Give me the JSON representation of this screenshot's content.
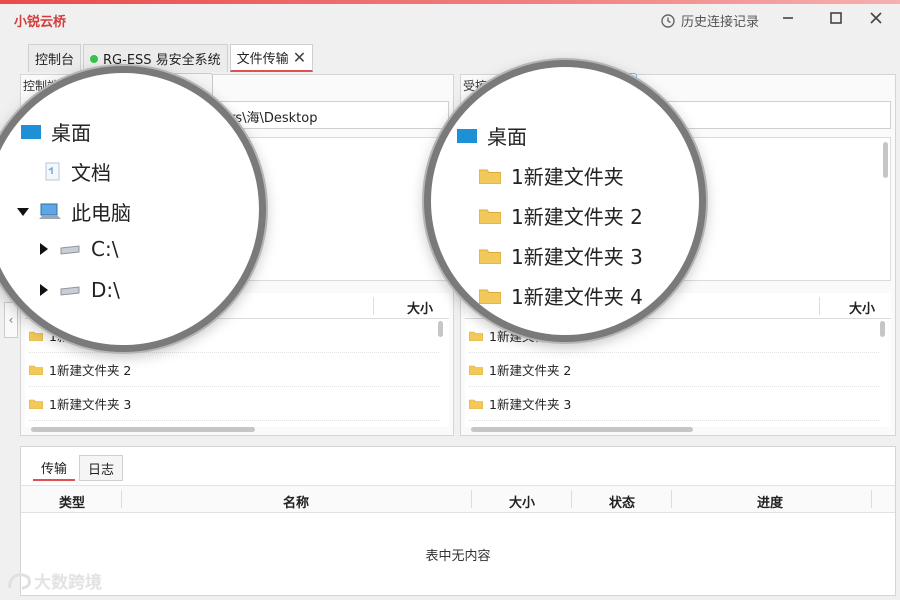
{
  "app": {
    "title": "小锐云桥",
    "history_label": "历史连接记录"
  },
  "tabs": [
    {
      "label": "控制台"
    },
    {
      "label": "RG-ESS 易安全系统",
      "status_color": "#37c24b"
    },
    {
      "label": "文件传输",
      "close": "✕"
    }
  ],
  "left_panel": {
    "header": "控制端",
    "path": "C:\\Users\\海\\Desktop",
    "path_visible": "ers\\海\\Desktop",
    "column_size": "大小",
    "files": [
      "1新建",
      "1新建文件夹 2",
      "1新建文件夹 3"
    ],
    "zoom_tree": [
      {
        "label": "桌面",
        "icon": "desktop-icon"
      },
      {
        "label": "文档",
        "icon": "document-icon"
      },
      {
        "label": "此电脑",
        "icon": "computer-icon",
        "expanded": true
      },
      {
        "label": "C:\\",
        "icon": "drive-icon"
      },
      {
        "label": "D:\\",
        "icon": "drive-icon"
      }
    ]
  },
  "right_panel": {
    "header": "受控端",
    "column_size": "大小",
    "files": [
      "1新建文件夹",
      "1新建文件夹 2",
      "1新建文件夹 3"
    ],
    "zoom_tree": [
      {
        "label": "桌面",
        "icon": "desktop-icon"
      },
      {
        "label": "1新建文件夹",
        "icon": "folder-icon"
      },
      {
        "label": "1新建文件夹 2",
        "icon": "folder-icon"
      },
      {
        "label": "1新建文件夹 3",
        "icon": "folder-icon"
      },
      {
        "label": "1新建文件夹 4",
        "icon": "folder-icon"
      }
    ]
  },
  "transfer": {
    "tabs": [
      "传输",
      "日志"
    ],
    "columns": [
      "类型",
      "名称",
      "大小",
      "状态",
      "进度"
    ],
    "empty_text": "表中无内容"
  },
  "watermark": "大数跨境",
  "colors": {
    "accent": "#e05050",
    "title": "#d23c3c",
    "folder": "#f2c85b",
    "desktop": "#1e90d6"
  }
}
